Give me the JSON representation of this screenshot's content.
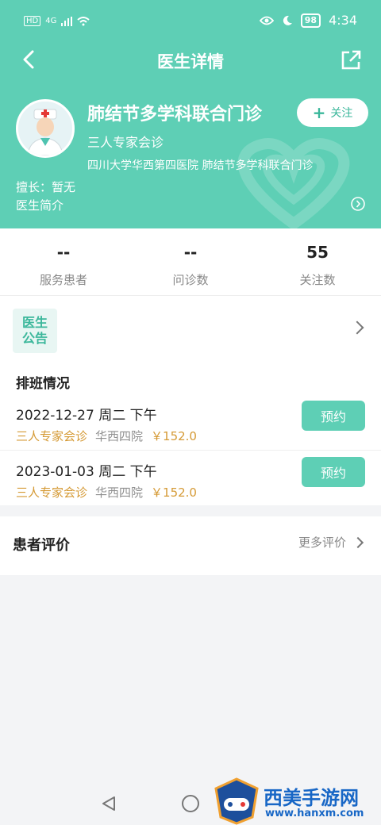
{
  "status_bar": {
    "left_labels": [
      "HD",
      "4G"
    ],
    "battery": "98",
    "time": "4:34"
  },
  "nav": {
    "title": "医生详情"
  },
  "doctor": {
    "name": "肺结节多学科联合门诊",
    "type": "三人专家会诊",
    "hospital": "四川大学华西第四医院  肺结节多学科联合门诊",
    "specialty": "擅长：暂无",
    "intro_label": "医生简介"
  },
  "follow_button": {
    "label": "关注"
  },
  "stats": [
    {
      "value": "--",
      "label": "服务患者"
    },
    {
      "value": "--",
      "label": "问诊数"
    },
    {
      "value": "55",
      "label": "关注数"
    }
  ],
  "notice": {
    "icon_text_line1": "医生",
    "icon_text_line2": "公告"
  },
  "schedule": {
    "title": "排班情况",
    "items": [
      {
        "date_line": "2022-12-27  周二  下午",
        "type": "三人专家会诊",
        "hospital": "华西四院",
        "price": "￥152.0",
        "button": "预约"
      },
      {
        "date_line": "2023-01-03  周二  下午",
        "type": "三人专家会诊",
        "hospital": "华西四院",
        "price": "￥152.0",
        "button": "预约"
      }
    ]
  },
  "reviews": {
    "title": "患者评价",
    "more": "更多评价"
  },
  "watermark": {
    "main": "西美手游网",
    "sub": "www.hanxm.com"
  },
  "colors": {
    "accent": "#5ecfb5",
    "orange": "#d59a35"
  }
}
